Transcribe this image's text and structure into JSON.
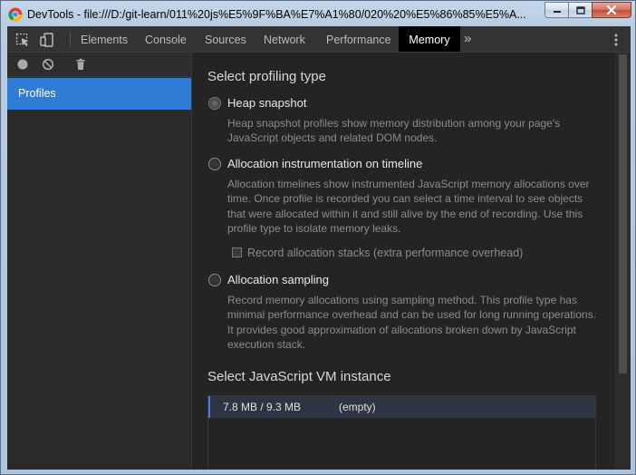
{
  "window": {
    "title": "DevTools - file:///D:/git-learn/011%20js%E5%9F%BA%E7%A1%80/020%20%E5%86%85%E5%A...",
    "app_icon": "chrome-logo"
  },
  "tabs": [
    {
      "label": "Elements"
    },
    {
      "label": "Console"
    },
    {
      "label": "Sources"
    },
    {
      "label": "Network"
    },
    {
      "label": "Performance"
    },
    {
      "label": "Memory"
    }
  ],
  "active_tab": "Memory",
  "more_tabs_glyph": "»",
  "sidebar": {
    "toolbar_icons": [
      "record-icon",
      "clear-icon",
      "trash-icon"
    ],
    "items": [
      {
        "label": "Profiles"
      }
    ]
  },
  "profiling": {
    "heading": "Select profiling type",
    "options": [
      {
        "label": "Heap snapshot",
        "selected": true,
        "description": "Heap snapshot profiles show memory distribution among your page's JavaScript objects and related DOM nodes."
      },
      {
        "label": "Allocation instrumentation on timeline",
        "selected": false,
        "description": "Allocation timelines show instrumented JavaScript memory allocations over time. Once profile is recorded you can select a time interval to see objects that were allocated within it and still alive by the end of recording. Use this profile type to isolate memory leaks.",
        "checkbox": {
          "label": "Record allocation stacks (extra performance overhead)",
          "checked": false
        }
      },
      {
        "label": "Allocation sampling",
        "selected": false,
        "description": "Record memory allocations using sampling method. This profile type has minimal performance overhead and can be used for long running operations. It provides good approximation of allocations broken down by JavaScript execution stack."
      }
    ]
  },
  "vm": {
    "heading": "Select JavaScript VM instance",
    "instances": [
      {
        "heap": "7.8 MB / 9.3 MB",
        "url": "(empty)"
      }
    ]
  },
  "colors": {
    "accent": "#2f7bd6",
    "panel_bg": "#242424",
    "tabbar_bg": "#333333"
  }
}
